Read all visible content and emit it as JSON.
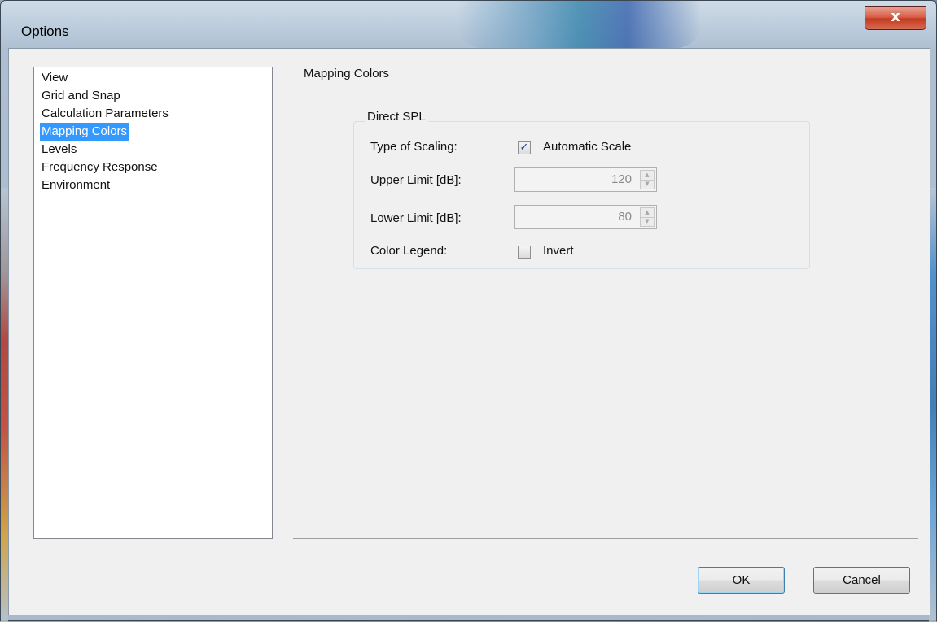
{
  "window": {
    "title": "Options",
    "close_glyph": "x"
  },
  "nav": {
    "items": [
      {
        "label": "View"
      },
      {
        "label": "Grid and Snap"
      },
      {
        "label": "Calculation Parameters"
      },
      {
        "label": "Mapping Colors",
        "selected": true
      },
      {
        "label": "Levels"
      },
      {
        "label": "Frequency Response"
      },
      {
        "label": "Environment"
      }
    ]
  },
  "panel": {
    "title": "Mapping Colors",
    "group_title": "Direct SPL",
    "type_of_scaling_label": "Type of Scaling:",
    "automatic_scale_label": "Automatic Scale",
    "automatic_scale_checked": true,
    "upper_limit_label": "Upper Limit [dB]:",
    "upper_limit_value": "120",
    "lower_limit_label": "Lower Limit [dB]:",
    "lower_limit_value": "80",
    "color_legend_label": "Color Legend:",
    "invert_label": "Invert",
    "invert_checked": false
  },
  "buttons": {
    "ok_label": "OK",
    "cancel_label": "Cancel"
  },
  "icons": {
    "close": "close-icon",
    "check": "checkmark-icon",
    "spin_up": "spin-up-arrow-icon",
    "spin_down": "spin-down-arrow-icon"
  },
  "colors": {
    "selection": "#3399ff",
    "dialog_bg": "#f0f0f0",
    "close_button": "#c23b22"
  }
}
